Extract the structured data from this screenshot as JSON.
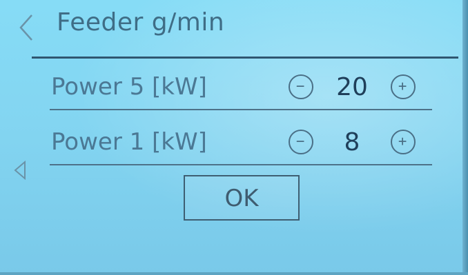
{
  "header": {
    "title": "Feeder g/min",
    "back_icon": "chevron-left-icon"
  },
  "rows": [
    {
      "label": "Power 5 [kW]",
      "value": "20",
      "minus_icon": "minus-circle-icon",
      "plus_icon": "plus-circle-icon"
    },
    {
      "label": "Power 1 [kW]",
      "value": "8",
      "minus_icon": "minus-circle-icon",
      "plus_icon": "plus-circle-icon"
    }
  ],
  "side_nav": {
    "icon": "triangle-left-icon"
  },
  "ok_button": {
    "label": "OK"
  },
  "colors": {
    "background": "#84d6f2",
    "text": "#4b7894",
    "value_text": "#1f3f5a",
    "rule": "#2f5670"
  }
}
